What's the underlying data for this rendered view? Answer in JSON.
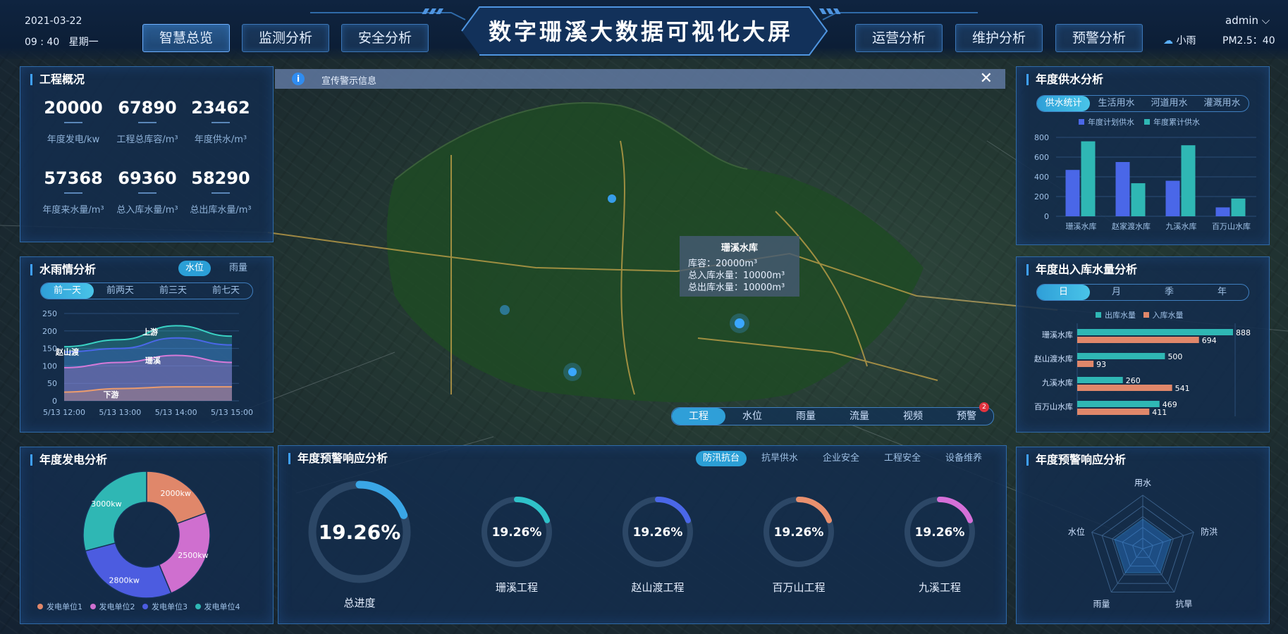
{
  "header": {
    "date": "2021-03-22",
    "time": "09 : 40",
    "weekday": "星期一",
    "title": "数字珊溪大数据可视化大屏",
    "nav_left": [
      "智慧总览",
      "监测分析",
      "安全分析"
    ],
    "nav_right": [
      "运营分析",
      "维护分析",
      "预警分析"
    ],
    "active_nav": "智慧总览",
    "user": "admin",
    "weather": "小雨",
    "pm": "PM2.5：40"
  },
  "overview": {
    "title": "工程概况",
    "stats": [
      {
        "value": "20000",
        "label": "年度发电/kw"
      },
      {
        "value": "67890",
        "label": "工程总库容/m³"
      },
      {
        "value": "23462",
        "label": "年度供水/m³"
      },
      {
        "value": "57368",
        "label": "年度来水量/m³"
      },
      {
        "value": "69360",
        "label": "总入库水量/m³"
      },
      {
        "value": "58290",
        "label": "总出库水量/m³"
      }
    ]
  },
  "rain": {
    "title": "水雨情分析",
    "pills": [
      "水位",
      "雨量"
    ],
    "tabs": [
      "前一天",
      "前两天",
      "前三天",
      "前七天"
    ],
    "series_labels": {
      "shangyou": "上游",
      "zhaoshandu": "赵山渡",
      "shanxi": "珊溪",
      "xiayou": "下游"
    }
  },
  "rain_chart": {
    "type": "area",
    "x": [
      "5/13 12:00",
      "5/13 13:00",
      "5/13 14:00",
      "5/13 15:00"
    ],
    "ylim": [
      0,
      250
    ],
    "yticks": [
      0,
      50,
      100,
      150,
      200,
      250
    ],
    "series": [
      {
        "name": "上游",
        "values": [
          155,
          175,
          215,
          185
        ],
        "color": "#3ad2c4"
      },
      {
        "name": "赵山渡",
        "values": [
          140,
          150,
          180,
          160
        ],
        "color": "#4a67e8"
      },
      {
        "name": "珊溪",
        "values": [
          95,
          110,
          130,
          110
        ],
        "color": "#d57ad8"
      },
      {
        "name": "下游",
        "values": [
          25,
          35,
          40,
          40
        ],
        "color": "#e99b6e"
      }
    ]
  },
  "power": {
    "title": "年度发电分析",
    "legend": [
      "发电单位1",
      "发电单位2",
      "发电单位3",
      "发电单位4"
    ]
  },
  "power_chart": {
    "type": "pie",
    "slices": [
      {
        "name": "发电单位1",
        "value": 2000,
        "label": "2000kw",
        "color": "#e0876a"
      },
      {
        "name": "发电单位2",
        "value": 2500,
        "label": "2500kw",
        "color": "#cf6fcf"
      },
      {
        "name": "发电单位3",
        "value": 2800,
        "label": "2800kw",
        "color": "#4c5ce0"
      },
      {
        "name": "发电单位4",
        "value": 3000,
        "label": "3000kw",
        "color": "#2fb7b4"
      }
    ]
  },
  "notice": {
    "text": "宣传警示信息"
  },
  "map": {
    "popup": {
      "title": "珊溪水库",
      "line1": "库容：20000m³",
      "line2": "总入库水量：10000m³",
      "line3": "总出库水量：10000m³"
    },
    "tabs": [
      "工程",
      "水位",
      "雨量",
      "流量",
      "视频",
      "预警"
    ],
    "badge": "2"
  },
  "response": {
    "title": "年度预警响应分析",
    "tabs": [
      "防汛抗台",
      "抗旱供水",
      "企业安全",
      "工程安全",
      "设备维养"
    ],
    "gauges": [
      {
        "label": "总进度",
        "value": "19.26%",
        "pct": 0.1926,
        "color": "#3aa6e6"
      },
      {
        "label": "珊溪工程",
        "value": "19.26%",
        "pct": 0.1926,
        "color": "#2fc2c9"
      },
      {
        "label": "赵山渡工程",
        "value": "19.26%",
        "pct": 0.1926,
        "color": "#4a67e8"
      },
      {
        "label": "百万山工程",
        "value": "19.26%",
        "pct": 0.1926,
        "color": "#e9906e"
      },
      {
        "label": "九溪工程",
        "value": "19.26%",
        "pct": 0.1926,
        "color": "#d56fd8"
      }
    ]
  },
  "supply": {
    "title": "年度供水分析",
    "tabs": [
      "供水统计",
      "生活用水",
      "河道用水",
      "灌溉用水"
    ],
    "legend": [
      "年度计划供水",
      "年度累计供水"
    ]
  },
  "supply_chart": {
    "type": "bar",
    "categories": [
      "珊溪水库",
      "赵家渡水库",
      "九溪水库",
      "百万山水库"
    ],
    "ylim": [
      0,
      800
    ],
    "yticks": [
      0,
      200,
      400,
      600,
      800
    ],
    "series": [
      {
        "name": "年度计划供水",
        "values": [
          470,
          550,
          360,
          90
        ],
        "color": "#4a67e8"
      },
      {
        "name": "年度累计供水",
        "values": [
          760,
          335,
          720,
          180
        ],
        "color": "#2fb7b4"
      }
    ]
  },
  "inout": {
    "title": "年度出入库水量分析",
    "tabs": [
      "日",
      "月",
      "季",
      "年"
    ],
    "legend": [
      "出库水量",
      "入库水量"
    ]
  },
  "inout_chart": {
    "type": "bar",
    "categories": [
      "珊溪水库",
      "赵山渡水库",
      "九溪水库",
      "百万山水库"
    ],
    "series": [
      {
        "name": "出库水量",
        "values": [
          888,
          500,
          260,
          469
        ],
        "color": "#2fb7b4"
      },
      {
        "name": "入库水量",
        "values": [
          694,
          93,
          541,
          411
        ],
        "color": "#e0876a"
      }
    ],
    "xmax": 900
  },
  "radar": {
    "title": "年度预警响应分析",
    "axes": [
      "用水",
      "防洪",
      "抗旱",
      "雨量",
      "水位"
    ],
    "values": [
      0.55,
      0.55,
      0.55,
      0.55,
      0.55
    ]
  }
}
